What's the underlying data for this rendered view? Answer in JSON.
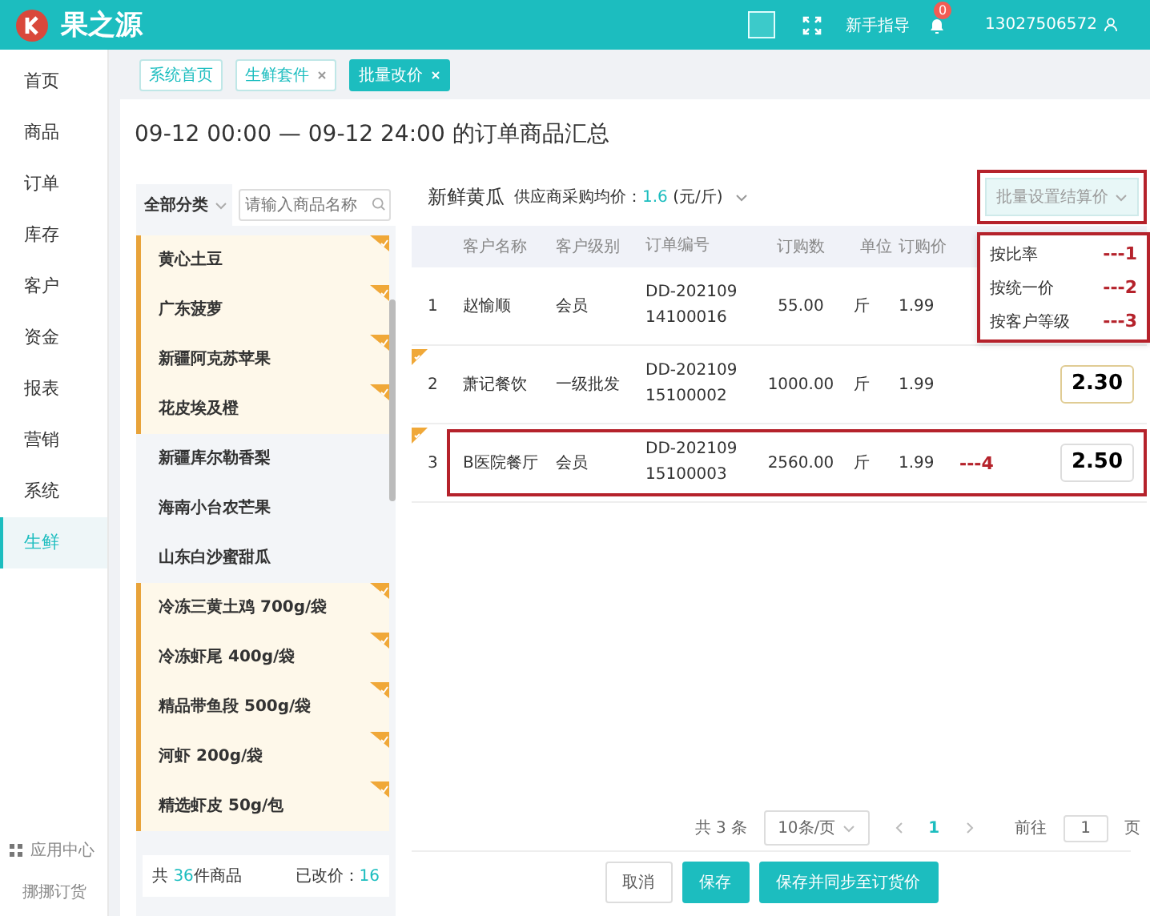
{
  "header": {
    "logo_text": "果之源",
    "guide": "新手指导",
    "notifications": "0",
    "user": "13027506572"
  },
  "sidebar": {
    "items": [
      {
        "label": "首页",
        "selected": false
      },
      {
        "label": "商品",
        "selected": false
      },
      {
        "label": "订单",
        "selected": false
      },
      {
        "label": "库存",
        "selected": false
      },
      {
        "label": "客户",
        "selected": false
      },
      {
        "label": "资金",
        "selected": false
      },
      {
        "label": "报表",
        "selected": false
      },
      {
        "label": "营销",
        "selected": false
      },
      {
        "label": "系统",
        "selected": false
      },
      {
        "label": "生鲜",
        "selected": true
      }
    ],
    "footer": {
      "apps": "应用中心",
      "brand": "挪挪订货"
    }
  },
  "tabs": [
    {
      "label": "系统首页",
      "closable": false,
      "selected": false
    },
    {
      "label": "生鲜套件",
      "closable": true,
      "selected": false
    },
    {
      "label": "批量改价",
      "closable": true,
      "selected": true
    }
  ],
  "title": "09-12 00:00 — 09-12 24:00 的订单商品汇总",
  "category_panel": {
    "filter": "全部分类",
    "search": {
      "placeholder": "请输入商品名称"
    },
    "products": [
      {
        "name": "黄心土豆",
        "modified": true
      },
      {
        "name": "广东菠萝",
        "modified": true
      },
      {
        "name": "新疆阿克苏苹果",
        "modified": true
      },
      {
        "name": "花皮埃及橙",
        "modified": true
      },
      {
        "name": "新疆库尔勒香梨",
        "modified": false
      },
      {
        "name": "海南小台农芒果",
        "modified": false
      },
      {
        "name": "山东白沙蜜甜瓜",
        "modified": false
      },
      {
        "name": "冷冻三黄土鸡 700g/袋",
        "modified": true
      },
      {
        "name": "冷冻虾尾 400g/袋",
        "modified": true
      },
      {
        "name": "精品带鱼段 500g/袋",
        "modified": true
      },
      {
        "name": "河虾 200g/袋",
        "modified": true
      },
      {
        "name": "精选虾皮 50g/包",
        "modified": true
      }
    ],
    "summary": {
      "total_prefix": "共",
      "total": "36",
      "total_suffix": "件商品",
      "changed_label": "已改价：",
      "changed": "16"
    }
  },
  "product": {
    "name": "新鲜黄瓜",
    "avg_label": "供应商采购均价：",
    "avg_value": "1.6",
    "avg_unit": "(元/斤)"
  },
  "batch_button": {
    "label": "批量设置结算价",
    "highlighted": true
  },
  "batch_menu": {
    "highlighted": true,
    "items": [
      {
        "label": "按比率",
        "note": "---1"
      },
      {
        "label": "按统一价",
        "note": "---2"
      },
      {
        "label": "按客户等级",
        "note": "---3"
      }
    ]
  },
  "table": {
    "columns": [
      "客户名称",
      "客户级别",
      "订单编号",
      "订购数",
      "单位",
      "订购价"
    ],
    "rows": [
      {
        "index": "1",
        "customer": "赵愉顺",
        "level": "会员",
        "order_no": [
          "DD-202109",
          "14100016"
        ],
        "qty": "55.00",
        "unit": "斤",
        "price": "1.99",
        "modified": false,
        "highlighted": false
      },
      {
        "index": "2",
        "customer": "萧记餐饮",
        "level": "一级批发",
        "order_no": [
          "DD-202109",
          "15100002"
        ],
        "qty": "1000.00",
        "unit": "斤",
        "price": "1.99",
        "settle": "2.30",
        "modified": true,
        "highlighted": false
      },
      {
        "index": "3",
        "customer": "B医院餐厅",
        "level": "会员",
        "order_no": [
          "DD-202109",
          "15100003"
        ],
        "qty": "2560.00",
        "unit": "斤",
        "price": "1.99",
        "settle": "2.50",
        "note": "---4",
        "modified": true,
        "highlighted": true
      }
    ]
  },
  "pagination": {
    "total": "共 3 条",
    "page_size": "10条/页",
    "pages": [
      {
        "label": "1",
        "selected": true
      }
    ],
    "goto_label": "前往",
    "goto_value": "1",
    "goto_suffix": "页"
  },
  "actions": [
    {
      "label": "取消",
      "kind": "default"
    },
    {
      "label": "保存",
      "kind": "primary"
    },
    {
      "label": "保存并同步至订货价",
      "kind": "primary"
    }
  ]
}
